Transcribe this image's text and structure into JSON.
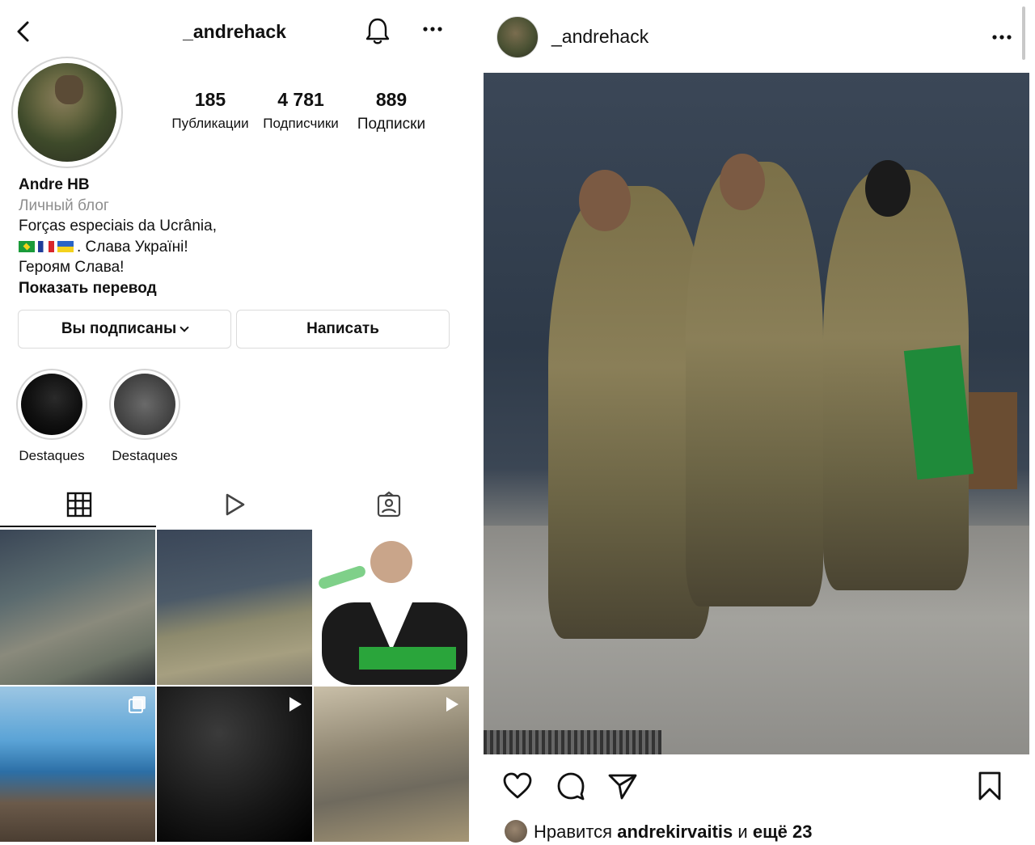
{
  "profile": {
    "username": "_andrehack",
    "stats": [
      {
        "value": "185",
        "label": "Публикации"
      },
      {
        "value": "4 781",
        "label": "Подписчики"
      },
      {
        "value": "889",
        "label": "Подписки"
      }
    ],
    "name": "Andre HB",
    "category": "Личный блог",
    "bio_line1": "Forças especiais da Ucrânia,",
    "bio_line2": ". Слава Україні!",
    "bio_line3": "Героям Слава!",
    "show_translation": "Показать перевод",
    "btn_following": "Вы подписаны",
    "btn_message": "Написать",
    "highlights": [
      {
        "label": "Destaques"
      },
      {
        "label": "Destaques"
      }
    ],
    "icons": {
      "back": "back-arrow-icon",
      "notifications": "bell-icon",
      "more": "more-dots-icon",
      "grid": "grid-icon",
      "reels": "reels-icon",
      "tagged": "tagged-icon"
    }
  },
  "post": {
    "username": "_andrehack",
    "likes_prefix": "Нравится",
    "likes_user": "andrekirvaitis",
    "likes_middle": "и",
    "likes_others": "ещё 23",
    "icons": {
      "like": "heart-icon",
      "comment": "comment-icon",
      "share": "send-icon",
      "save": "bookmark-icon"
    }
  },
  "colors": {
    "text": "#111111",
    "muted": "#8e8e8e",
    "border": "#dbdbdb",
    "background": "#ffffff"
  }
}
